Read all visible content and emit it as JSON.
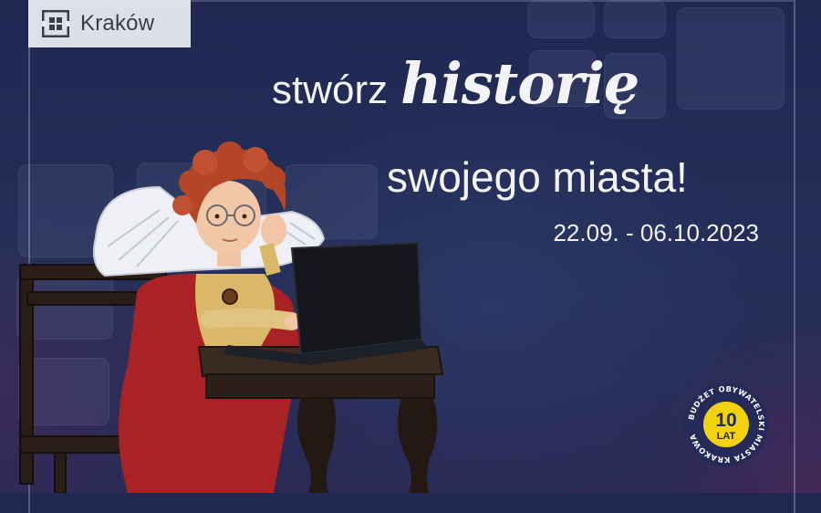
{
  "brand": {
    "logo_text": "Kraków",
    "logo_icon": "krakow-mark-icon"
  },
  "headline": {
    "word1": "stwórz",
    "word2": "historię",
    "line2": "swojego miasta!"
  },
  "dates": "22.09. - 06.10.2023",
  "badge": {
    "number": "10",
    "unit": "LAT",
    "ring_text": "BUDŻET OBYWATELSKI MIASTA KRAKOWA"
  },
  "colors": {
    "background": "#222a55",
    "headline": "#f4f4f8",
    "badge_yellow": "#f2d10d",
    "dress_red": "#b3262a",
    "hair": "#b8482a"
  }
}
